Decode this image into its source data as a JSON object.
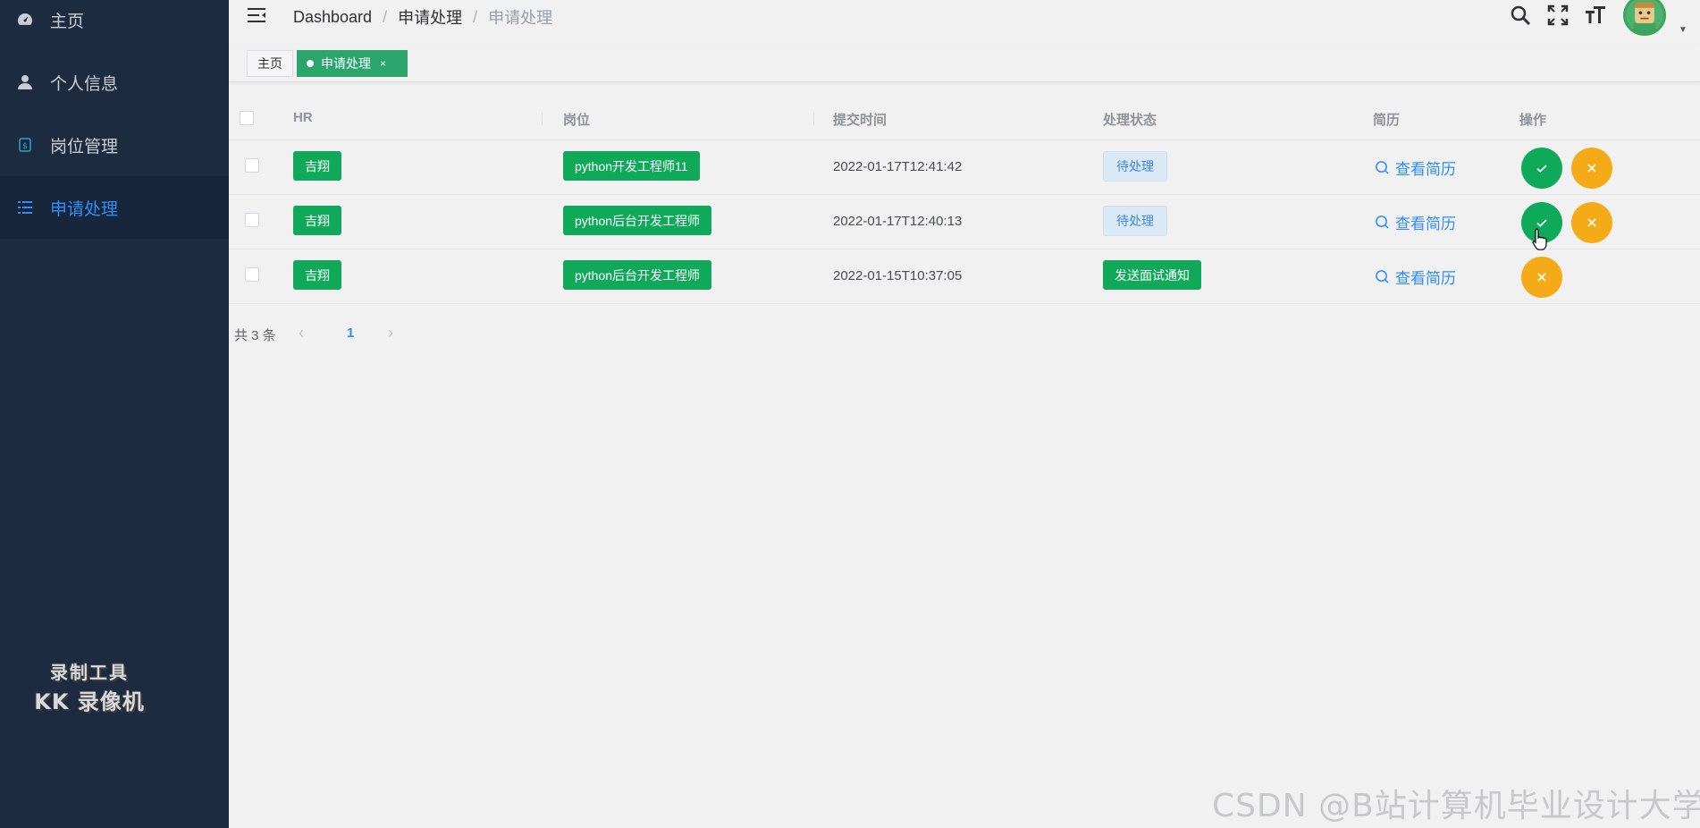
{
  "sidebar": {
    "items": [
      {
        "label": "主页",
        "icon": "dashboard-icon"
      },
      {
        "label": "个人信息",
        "icon": "user-icon"
      },
      {
        "label": "岗位管理",
        "icon": "money-icon"
      },
      {
        "label": "申请处理",
        "icon": "list-icon"
      }
    ],
    "watermark_line1": "录制工具",
    "watermark_line2": "KK 录像机"
  },
  "header": {
    "breadcrumb": [
      "Dashboard",
      "申请处理",
      "申请处理"
    ]
  },
  "tags": {
    "home": "主页",
    "active": "申请处理",
    "close": "×"
  },
  "table": {
    "columns": [
      "HR",
      "岗位",
      "提交时间",
      "处理状态",
      "简历",
      "操作"
    ],
    "rows": [
      {
        "hr": "吉翔",
        "job": "python开发工程师11",
        "time": "2022-01-17T12:41:42",
        "status": "待处理",
        "status_type": "pending",
        "resume": "查看简历"
      },
      {
        "hr": "吉翔",
        "job": "python后台开发工程师",
        "time": "2022-01-17T12:40:13",
        "status": "待处理",
        "status_type": "pending",
        "resume": "查看简历"
      },
      {
        "hr": "吉翔",
        "job": "python后台开发工程师",
        "time": "2022-01-15T10:37:05",
        "status": "发送面试通知",
        "status_type": "sent",
        "resume": "查看简历"
      }
    ]
  },
  "pagination": {
    "total": "共 3 条",
    "current": "1"
  },
  "colors": {
    "sidebar_bg": "#1c2b40",
    "active_blue": "#2f8dfa",
    "green": "#10a95a",
    "orange": "#f4ab17"
  },
  "watermark": "CSDN @B站计算机毕业设计大学"
}
